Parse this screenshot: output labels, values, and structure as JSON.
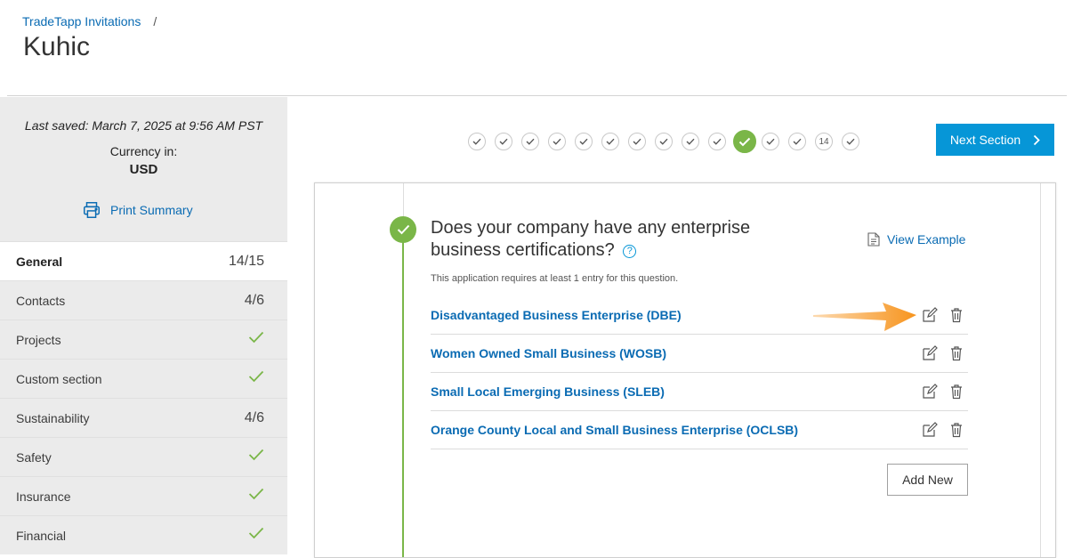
{
  "breadcrumb": {
    "parent": "TradeTapp Invitations",
    "separator": "/"
  },
  "page_title": "Kuhic",
  "summary": {
    "last_saved": "Last saved: March 7, 2025 at 9:56 AM PST",
    "currency_label": "Currency in:",
    "currency_value": "USD",
    "print_label": "Print Summary"
  },
  "nav": [
    {
      "label": "General",
      "status": "14/15",
      "active": true
    },
    {
      "label": "Contacts",
      "status": "4/6"
    },
    {
      "label": "Projects",
      "status": "check"
    },
    {
      "label": "Custom section",
      "status": "check"
    },
    {
      "label": "Sustainability",
      "status": "4/6"
    },
    {
      "label": "Safety",
      "status": "check"
    },
    {
      "label": "Insurance",
      "status": "check"
    },
    {
      "label": "Financial",
      "status": "check"
    }
  ],
  "steps": [
    "check",
    "check",
    "check",
    "check",
    "check",
    "check",
    "check",
    "check",
    "check",
    "check",
    "current",
    "check",
    "check",
    "14",
    "check"
  ],
  "next_button": "Next Section",
  "question": {
    "text": "Does your company have any enterprise business certifications?",
    "help": "?",
    "view_example": "View Example",
    "requirement": "This application requires at least 1 entry for this question.",
    "entries": [
      "Disadvantaged Business Enterprise (DBE)",
      "Women Owned Small Business (WOSB)",
      "Small Local Emerging Business (SLEB)",
      "Orange County Local and Small Business Enterprise (OCLSB)"
    ],
    "add_new": "Add New"
  },
  "colors": {
    "accent": "#0696d7",
    "link": "#0a6bb3",
    "success": "#7ab648",
    "annotation": "#f7941d"
  }
}
